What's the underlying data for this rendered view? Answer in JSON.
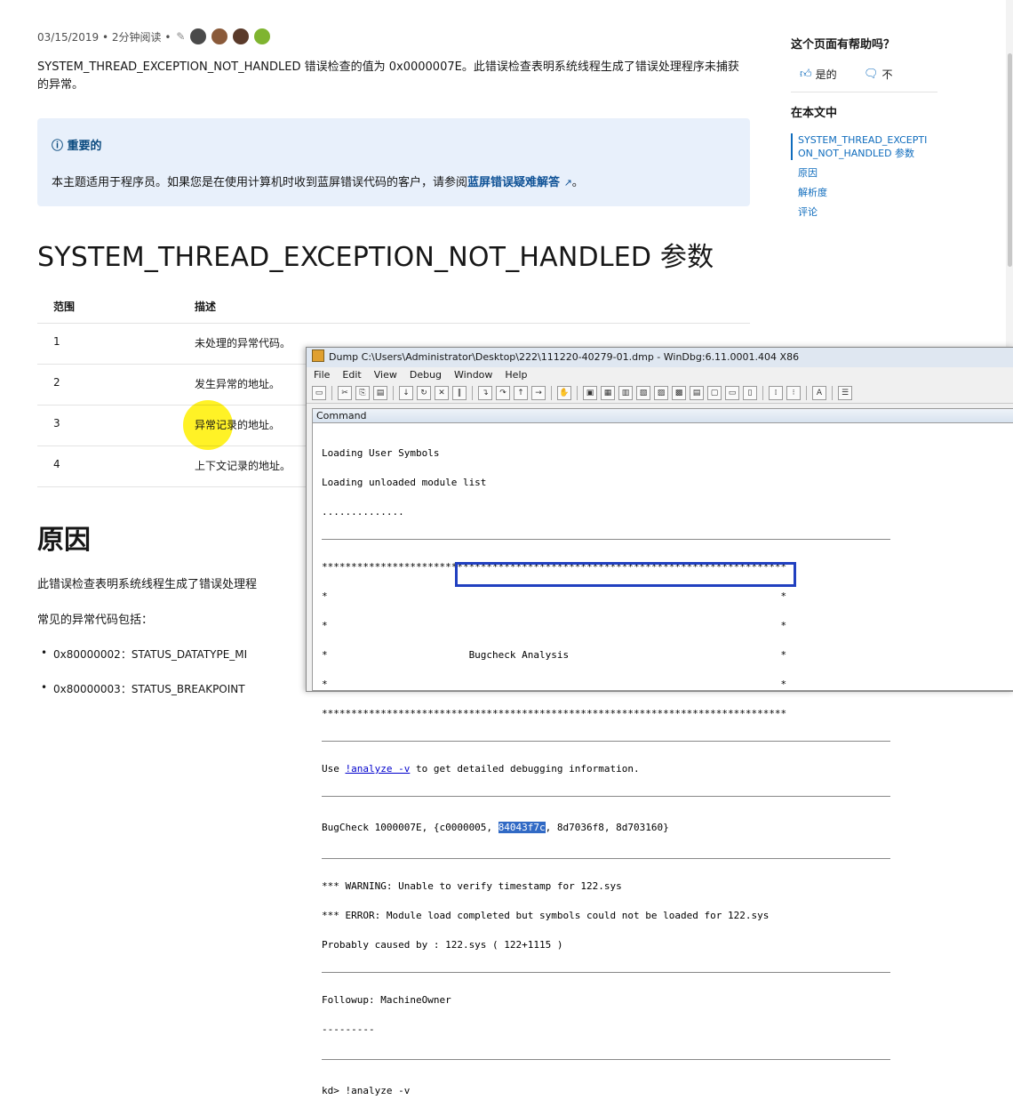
{
  "article": {
    "meta": "03/15/2019 • 2分钟阅读 •",
    "intro": "SYSTEM_THREAD_EXCEPTION_NOT_HANDLED 错误检查的值为 0x0000007E。此错误检查表明系统线程生成了错误处理程序未捕获的异常。",
    "alert": {
      "title": "ⓘ 重要的",
      "body_prefix": "本主题适用于程序员。如果您是在使用计算机时收到蓝屏错误代码的客户，请参阅",
      "link": "蓝屏错误疑难解答",
      "body_suffix": "。"
    },
    "param_heading": "SYSTEM_THREAD_EXCEPTION_NOT_HANDLED 参数",
    "table": {
      "headers": [
        "范围",
        "描述"
      ],
      "rows": [
        [
          "1",
          "未处理的异常代码。"
        ],
        [
          "2",
          "发生异常的地址。"
        ],
        [
          "3",
          "异常记录的地址。"
        ],
        [
          "4",
          "上下文记录的地址。"
        ]
      ]
    },
    "cause_heading": "原因",
    "cause_para": "此错误检查表明系统线程生成了错误处理程",
    "codes_intro": "常见的异常代码包括：",
    "codes": [
      "0x80000002：STATUS_DATATYPE_MI",
      "0x80000003：STATUS_BREAKPOINT"
    ]
  },
  "sidebar": {
    "helpful_q": "这个页面有帮助吗？",
    "yes": "是的",
    "no": "不",
    "toc_title": "在本文中",
    "toc": [
      "SYSTEM_THREAD_EXCEPTION_NOT_HANDLED 参数",
      "原因",
      "解析度",
      "评论"
    ]
  },
  "windbg": {
    "title": "Dump C:\\Users\\Administrator\\Desktop\\222\\111220-40279-01.dmp - WinDbg:6.11.0001.404 X86",
    "menu": [
      "File",
      "Edit",
      "View",
      "Debug",
      "Window",
      "Help"
    ],
    "pane_title": "Command",
    "lines": {
      "l1": "Loading User Symbols",
      "l2": "Loading unloaded module list",
      "l3": "..............",
      "stars": "*******************************************************************************",
      "star_edge": "*                                                                             *",
      "bugcheck_analysis": "*                        Bugcheck Analysis                                    *",
      "use_prefix": "Use ",
      "use_link": "!analyze -v",
      "use_suffix": " to get detailed debugging information.",
      "bc_prefix": "BugCheck 1000007E, {c0000005, ",
      "bc_selected": "84043f7c",
      "bc_suffix": ", 8d7036f8, 8d703160}",
      "warn1": "*** WARNING: Unable to verify timestamp for 122.sys",
      "warn2": "*** ERROR: Module load completed but symbols could not be loaded for 122.sys",
      "warn3": "Probably caused by : 122.sys ( 122+1115 )",
      "followup": "Followup: MachineOwner",
      "dashes": "---------",
      "kd": "kd> !analyze -v"
    }
  },
  "colors": {
    "link": "#0f6cbd",
    "alert_bg": "#e8f0fb",
    "highlight_box": "#2140c0",
    "cursor_highlight": "#fff000"
  }
}
